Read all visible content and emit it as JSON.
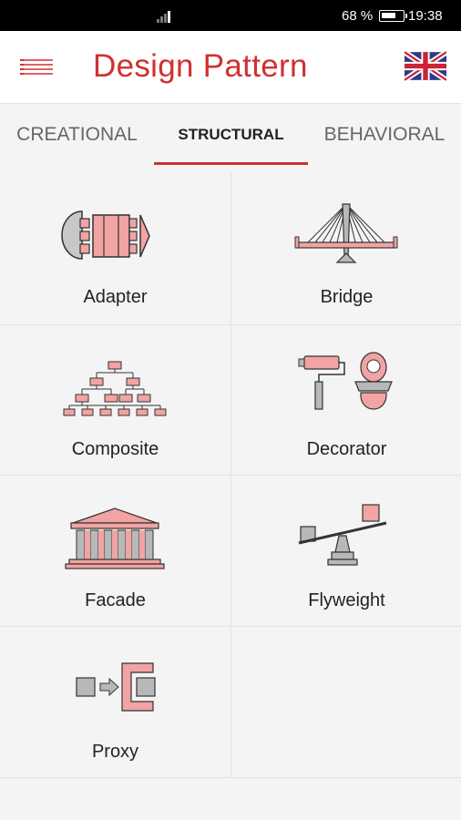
{
  "status_bar": {
    "battery_percent": "68 %",
    "time": "19:38"
  },
  "app_bar": {
    "title": "Design Pattern",
    "menu_icon": "menu-lines-icon",
    "language_icon": "uk-flag-icon"
  },
  "tabs": [
    {
      "label": "CREATIONAL",
      "active": false
    },
    {
      "label": "STRUCTURAL",
      "active": true
    },
    {
      "label": "BEHAVIORAL",
      "active": false
    }
  ],
  "patterns": [
    {
      "label": "Adapter",
      "icon": "adapter-icon"
    },
    {
      "label": "Bridge",
      "icon": "bridge-icon"
    },
    {
      "label": "Composite",
      "icon": "composite-tree-icon"
    },
    {
      "label": "Decorator",
      "icon": "decorator-icon"
    },
    {
      "label": "Facade",
      "icon": "facade-building-icon"
    },
    {
      "label": "Flyweight",
      "icon": "flyweight-seesaw-icon"
    },
    {
      "label": "Proxy",
      "icon": "proxy-icon"
    }
  ],
  "colors": {
    "accent": "#d03030",
    "icon_fill": "#f2a3a3",
    "icon_gray": "#b8b8b8"
  }
}
